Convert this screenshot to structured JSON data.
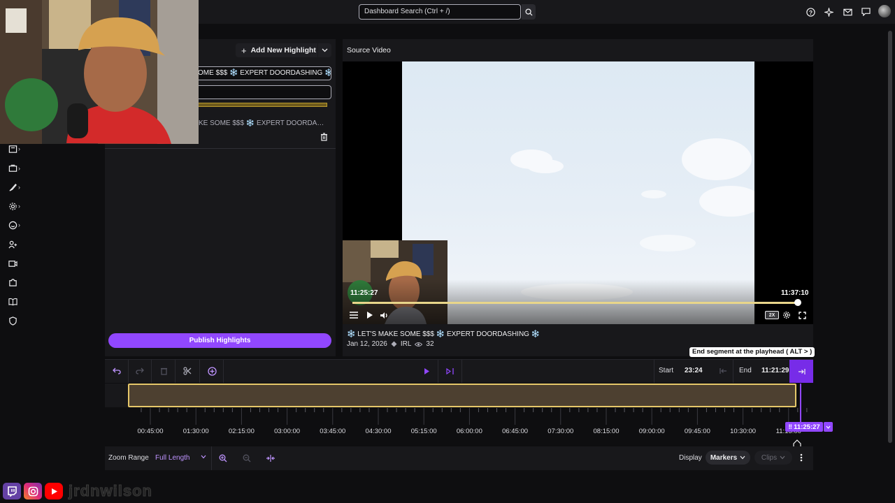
{
  "topbar": {
    "search_placeholder": "Dashboard Search (Ctrl + /)"
  },
  "highlights": {
    "add_label": "Add New Highlight",
    "title_value": "OME $$$ ❄️ EXPERT DOORDASHING ❄️",
    "clip_title": "KE SOME $$$ ❄️ EXPERT DOORDASHI...",
    "publish_label": "Publish Highlights"
  },
  "source_video": {
    "label": "Source Video",
    "time_start": "11:25:27",
    "time_end": "11:37:10",
    "speed": "2X",
    "title": "❄️ LET'S MAKE SOME $$$ ❄️ EXPERT DOORDASHING ❄️",
    "date": "Jan 12, 2026",
    "category": "IRL",
    "views": "32",
    "progress_fraction": 0.99
  },
  "tooltip": "End segment at the playhead ( ALT > )",
  "timeline": {
    "start_label": "Start",
    "start_value": "23:24",
    "end_label": "End",
    "end_value": "11:21:29",
    "ticks": [
      "00:45:00",
      "01:30:00",
      "02:15:00",
      "03:00:00",
      "03:45:00",
      "04:30:00",
      "05:15:00",
      "06:00:00",
      "06:45:00",
      "07:30:00",
      "08:15:00",
      "09:00:00",
      "09:45:00",
      "10:30:00",
      "11:15:00"
    ],
    "playhead": "11:25:27"
  },
  "bottom": {
    "zoom_label": "Zoom Range",
    "zoom_value": "Full Length",
    "display_label": "Display",
    "markers_label": "Markers",
    "clips_label": "Clips"
  },
  "overlay": {
    "handle": "jrdnwilson"
  },
  "colors": {
    "accent": "#9147ff",
    "segment": "#e6c86a",
    "background": "#0e0e10",
    "panel": "#18181b"
  }
}
